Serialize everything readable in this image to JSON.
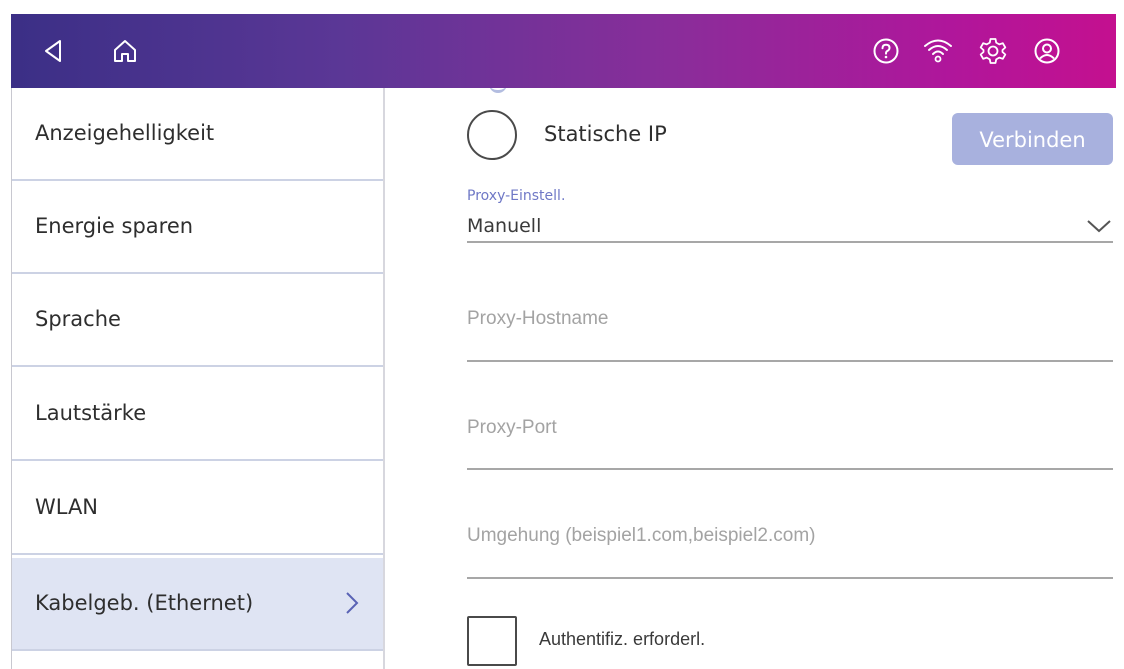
{
  "topbar": {
    "left_icons": [
      "back-icon",
      "home-icon"
    ],
    "right_icons": [
      "help-icon",
      "wifi-icon",
      "settings-icon",
      "account-icon"
    ],
    "gradient": [
      "#3b2f86",
      "#c4108f"
    ]
  },
  "sidebar": {
    "items": [
      {
        "label": "Anzeigehelligkeit"
      },
      {
        "label": "Energie sparen"
      },
      {
        "label": "Sprache"
      },
      {
        "label": "Lautstärke"
      },
      {
        "label": "WLAN"
      },
      {
        "label": "Kabelgeb. (Ethernet)",
        "selected": true
      }
    ],
    "active_color": "#dfe4f3"
  },
  "main": {
    "static_ip": {
      "label": "Statische IP",
      "checked": false
    },
    "connect_button": {
      "label": "Verbinden",
      "color": "#a8b1de"
    },
    "proxy_settings": {
      "label": "Proxy-Einstell.",
      "value": "Manuell"
    },
    "proxy_hostname": {
      "placeholder": "Proxy-Hostname",
      "value": ""
    },
    "proxy_port": {
      "placeholder": "Proxy-Port",
      "value": ""
    },
    "bypass": {
      "placeholder": "Umgehung (beispiel1.com,beispiel2.com)",
      "value": ""
    },
    "auth_required": {
      "label": "Authentifiz. erforderl.",
      "checked": false
    }
  }
}
